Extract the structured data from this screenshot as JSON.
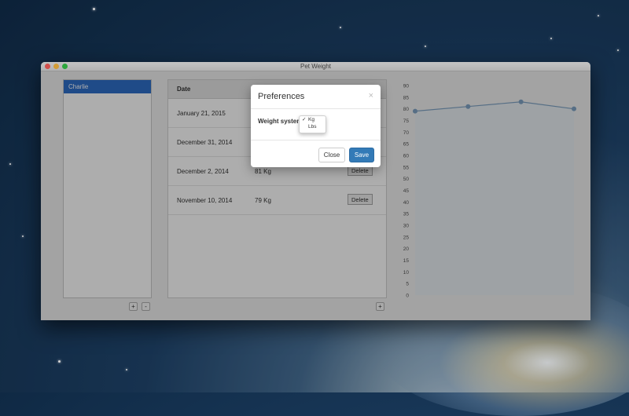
{
  "window": {
    "title": "Pet Weight"
  },
  "pets": {
    "items": [
      {
        "name": "Charlie",
        "selected": true
      }
    ],
    "add_label": "+",
    "remove_label": "-"
  },
  "table": {
    "header_date": "Date",
    "rows": [
      {
        "date": "January 21, 2015",
        "weight": ""
      },
      {
        "date": "December 31, 2014",
        "weight": ""
      },
      {
        "date": "December 2, 2014",
        "weight": "81 Kg"
      },
      {
        "date": "November 10, 2014",
        "weight": "79 Kg"
      }
    ],
    "delete_label": "Delete",
    "add_label": "+"
  },
  "preferences": {
    "title": "Preferences",
    "close_x": "×",
    "weight_label": "Weight system",
    "options": [
      {
        "label": "Kg",
        "checked": true
      },
      {
        "label": "Lbs",
        "checked": false
      }
    ],
    "check_mark": "✓",
    "close_button": "Close",
    "save_button": "Save",
    "save_color": "#337ab7"
  },
  "chart_data": {
    "type": "line",
    "y_ticks": [
      0,
      5,
      10,
      15,
      20,
      25,
      30,
      35,
      40,
      45,
      50,
      55,
      60,
      65,
      70,
      75,
      80,
      85,
      90
    ],
    "ylim": [
      0,
      90
    ],
    "x": [
      0,
      1,
      2,
      3
    ],
    "values": [
      79,
      81,
      83,
      80
    ],
    "color": "#7fa3c4",
    "fill": "#e9eef3",
    "grid": false
  }
}
